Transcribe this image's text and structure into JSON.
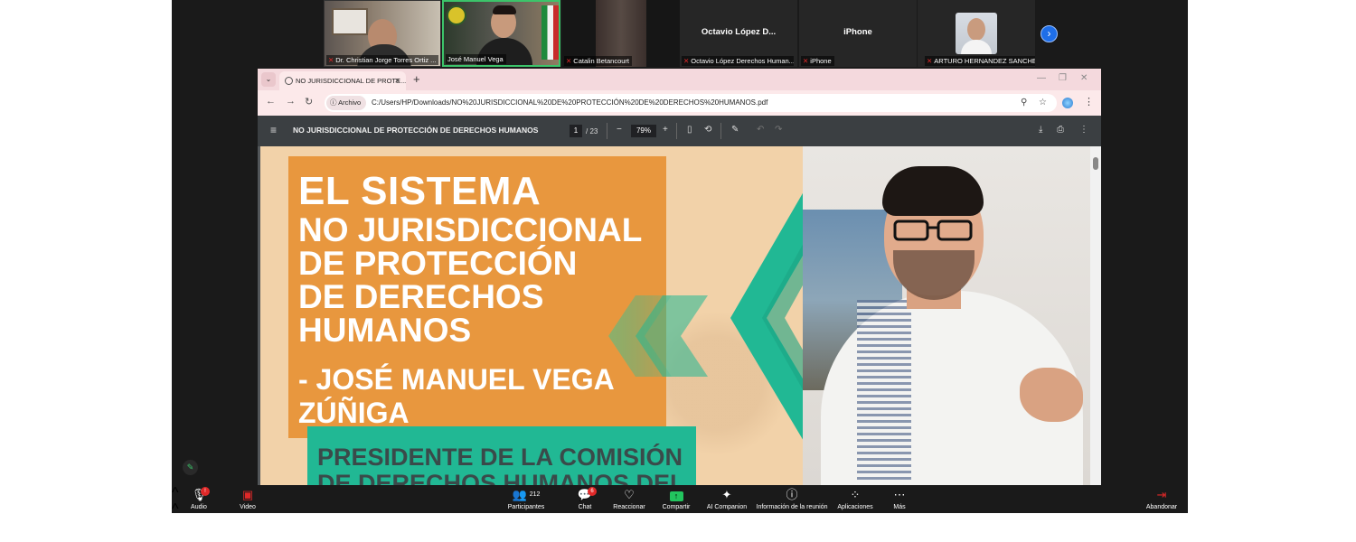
{
  "gallery": {
    "participants": [
      {
        "name": "Dr. Christian Jorge Torres Ortiz ..."
      },
      {
        "name": "José Manuel Vega"
      },
      {
        "name": "Catalin Betancourt"
      },
      {
        "name": "Octavio López Derechos Human...",
        "display": "Octavio  López  D..."
      },
      {
        "name": "iPhone",
        "display": "iPhone"
      },
      {
        "name": "ARTURO HERNANDEZ SANCHEZ"
      }
    ],
    "next_icon": "chevron-right-icon"
  },
  "browser": {
    "tab_title": "NO JURISDICCIONAL DE PROTE...",
    "new_tab": "+",
    "site_chip": "Archivo",
    "url": "C:/Users/HP/Downloads/NO%20JURISDICCIONAL%20DE%20PROTECCIÓN%20DE%20DERECHOS%20HUMANOS.pdf"
  },
  "pdf": {
    "title": "NO JURISDICCIONAL DE PROTECCIÓN DE DERECHOS HUMANOS",
    "page": "1",
    "page_count": "/ 23",
    "zoom": "79%"
  },
  "slide": {
    "title": "EL SISTEMA",
    "subtitle_lines": [
      "NO JURISDICCIONAL",
      "DE PROTECCIÓN",
      "DE DERECHOS",
      "HUMANOS"
    ],
    "author_lines": [
      "- JOSÉ MANUEL VEGA",
      "ZÚÑIGA"
    ],
    "position_lines": [
      "PRESIDENTE DE LA COMISIÓN",
      "DE DERECHOS HUMANOS DEL"
    ],
    "colors": {
      "orange": "#e8973e",
      "green": "#21b894",
      "background": "#f2d2a9"
    }
  },
  "controls": {
    "audio": "Audio",
    "video": "Video",
    "participants": "Participantes",
    "participants_count": "212",
    "chat": "Chat",
    "chat_badge": "6",
    "react": "Reaccionar",
    "share": "Compartir",
    "ai": "AI Companion",
    "info": "Información de la reunión",
    "apps": "Aplicaciones",
    "more": "Más",
    "leave": "Abandonar"
  }
}
